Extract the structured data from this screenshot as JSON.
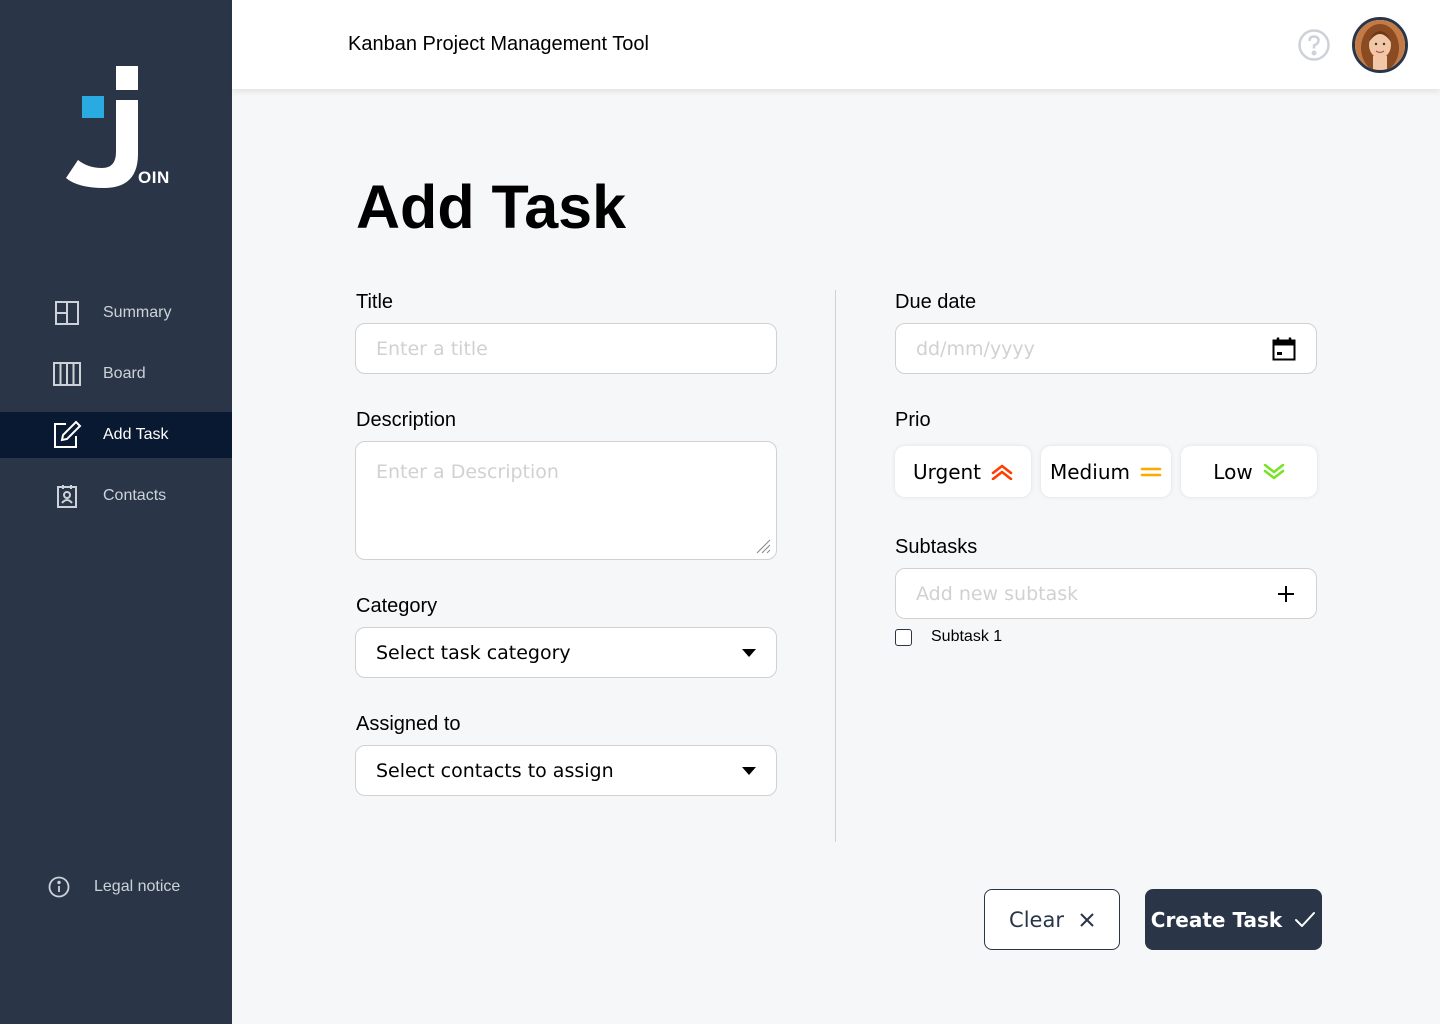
{
  "app": {
    "logo_text": "OIN",
    "title": "Kanban Project Management Tool"
  },
  "sidebar": {
    "items": [
      {
        "label": "Summary",
        "icon": "summary-icon"
      },
      {
        "label": "Board",
        "icon": "board-icon"
      },
      {
        "label": "Add Task",
        "icon": "add-task-icon",
        "active": true
      },
      {
        "label": "Contacts",
        "icon": "contacts-icon"
      }
    ],
    "legal": "Legal notice"
  },
  "page": {
    "title": "Add Task"
  },
  "form": {
    "title_label": "Title",
    "title_placeholder": "Enter a title",
    "description_label": "Description",
    "description_placeholder": "Enter a Description",
    "category_label": "Category",
    "category_value": "Select task category",
    "assigned_label": "Assigned to",
    "assigned_value": "Select contacts to assign",
    "due_label": "Due date",
    "due_placeholder": "dd/mm/yyyy",
    "prio_label": "Prio",
    "prio": {
      "urgent": "Urgent",
      "medium": "Medium",
      "low": "Low"
    },
    "subtasks_label": "Subtasks",
    "subtask_placeholder": "Add  new subtask",
    "subtasks": [
      "Subtask 1"
    ]
  },
  "buttons": {
    "clear": "Clear",
    "create": "Create Task"
  },
  "colors": {
    "sidebar": "#2a3647",
    "active": "#091931",
    "accent": "#29abe2",
    "urgent": "#ff3d00",
    "medium": "#ffa800",
    "low": "#7ae229"
  }
}
